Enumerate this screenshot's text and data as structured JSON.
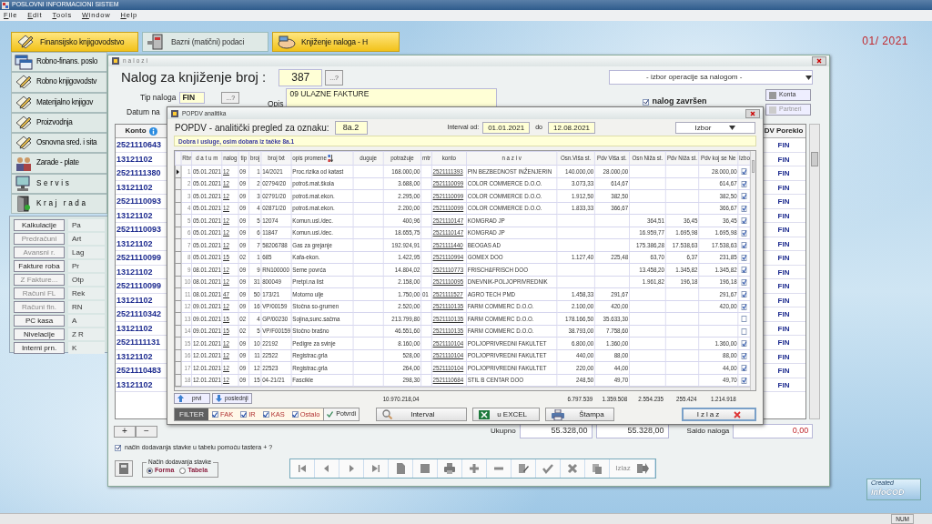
{
  "app": {
    "title": "POSLOVNI INFORMACIONI SISTEM",
    "period": "01/ 2021",
    "status": "NUM",
    "logo_lines": [
      "Created",
      "InfoCOD"
    ]
  },
  "menu": [
    "File",
    "Edit",
    "Tools",
    "Window",
    "Help"
  ],
  "modules_top": [
    {
      "label": "Finansijsko knjigovodstvo",
      "selected": true
    },
    {
      "label": "Bazni (matični) podaci",
      "selected": false
    },
    {
      "label": "Knjiženje naloga - H",
      "selected": true
    }
  ],
  "modules_side": [
    {
      "label": "Robno-finans. poslo",
      "kind": "plain"
    },
    {
      "label": "Robno knjigovodstv",
      "kind": "plain"
    },
    {
      "label": "Materijalno knjigov",
      "kind": "plain"
    },
    {
      "label": "Proizvodnja",
      "kind": "plain"
    },
    {
      "label": "Osnovna sred. i sita",
      "kind": "plain"
    },
    {
      "label": "Zarade - plate",
      "kind": "plain"
    },
    {
      "label": "Servis",
      "kind": "spaced"
    },
    {
      "label": "Kraj rada",
      "kind": "spaced"
    }
  ],
  "submenu": {
    "left": [
      {
        "label": "Kalkulacije",
        "disabled": false
      },
      {
        "label": "Predračuni",
        "disabled": true
      },
      {
        "label": "Avansni r.",
        "disabled": true
      },
      {
        "label": "Fakture roba",
        "disabled": false
      },
      {
        "label": "Z Fakture...",
        "disabled": true
      },
      {
        "label": "Računi FL",
        "disabled": true
      },
      {
        "label": "Računi fin.",
        "disabled": true
      },
      {
        "label": "PC kasa",
        "disabled": false
      },
      {
        "label": "Nivelacije",
        "disabled": false
      },
      {
        "label": "Interni prn.",
        "disabled": false
      }
    ],
    "right": [
      "Pa",
      "Art",
      "Lag",
      "Pr",
      "Otp",
      "Rek",
      "RN",
      "A",
      "Z R",
      "K"
    ]
  },
  "nalozi": {
    "title": "nalozi",
    "heading": "Nalog za knjiženje broj :",
    "number": "387",
    "lookup": "...?",
    "operation": "- izbor operacije sa nalogom -",
    "type_label": "Tip naloga",
    "type_value": "FIN",
    "type_lookup": "...?",
    "desc_label": "Opis",
    "desc_value": "09  ULAZNE FAKTURE",
    "date_label": "Datum na",
    "finished": {
      "label": "nalog završen",
      "checked": true
    },
    "buttons": [
      {
        "label": "Konta",
        "disabled": false
      },
      {
        "label": "Partneri",
        "disabled": true
      }
    ],
    "konto_header": "Konto",
    "konto": [
      "2521110643",
      "13121102",
      "2521111380",
      "13121102",
      "2521110093",
      "13121102",
      "2521110093",
      "13121102",
      "2521110099",
      "13121102",
      "2521110099",
      "13121102",
      "2521110342",
      "13121102",
      "2521111131",
      "13121102",
      "2521110483",
      "13121102"
    ],
    "origin_header": "DV Poreklo",
    "origin": [
      "FIN",
      "FIN",
      "FIN",
      "FIN",
      "FIN",
      "FIN",
      "FIN",
      "FIN",
      "FIN",
      "FIN",
      "FIN",
      "FIN",
      "FIN",
      "FIN",
      "FIN",
      "FIN",
      "FIN",
      "FIN"
    ],
    "row_buttons": [
      "+",
      "−"
    ],
    "total_label": "Ukupno",
    "totals": [
      "55.328,00",
      "55.328,00"
    ],
    "saldo_label": "Saldo naloga",
    "saldo": "0,00",
    "add_with_key": {
      "label": "način dodavanja stavke u tabelu pomoću tastera + ?",
      "checked": true
    },
    "add_mode": {
      "label": "Način dodavanja stavke",
      "options": [
        {
          "label": "Forma",
          "selected": true
        },
        {
          "label": "Tabela",
          "selected": false
        }
      ]
    },
    "exit_label": "Izlaz"
  },
  "popdv": {
    "title": "POPDV analitika",
    "heading": "POPDV - analitički pregled za oznaku:",
    "code": "8a.2",
    "from_label": "Interval od:",
    "from": "01.01.2021",
    "to_label": "do",
    "to": "12.08.2021",
    "choice": "Izbor",
    "subtitle": "Dobra i usluge, osim dobara iz tačke 8a.1",
    "columns": [
      "Rbr",
      "d a t u m",
      "nalog",
      "tip",
      "broj",
      "broj txt",
      "opis promene",
      "duguje",
      "potražuje",
      "mtr",
      "konto",
      "n a z i v",
      "Osn.Viša st.",
      "Pdv Viša st.",
      "Osn Niža st.",
      "Pdv Niža st.",
      "Pdv koj se Ne",
      "Izbo"
    ],
    "rows": [
      {
        "selected": true,
        "checked": true,
        "rbr": "1",
        "datum": "05.01.2021",
        "nalog": "12",
        "tip": "09",
        "broj": "1",
        "broj_txt": "14/2021",
        "opis": "Proc.rizika od katast",
        "potrazuje": "168.000,00",
        "konto": "2521111393",
        "naziv": "PIN BEZBEDNOST INŽENJERIN",
        "osn_visa": "140.000,00",
        "pdv_visa": "28.000,00",
        "pdv_koji": "28.000,00"
      },
      {
        "selected": false,
        "checked": true,
        "rbr": "2",
        "datum": "05.01.2021",
        "nalog": "12",
        "tip": "09",
        "broj": "2",
        "broj_txt": "02794/20",
        "opis": "potroš.mat.škola",
        "potrazuje": "3.688,00",
        "konto": "2521110099",
        "naziv": "COLOR COMMERCE D.O.O.",
        "osn_visa": "3.073,33",
        "pdv_visa": "614,67",
        "pdv_koji": "614,67"
      },
      {
        "selected": false,
        "checked": true,
        "rbr": "3",
        "datum": "05.01.2021",
        "nalog": "12",
        "tip": "09",
        "broj": "3",
        "broj_txt": "02791/20",
        "opis": "potroš.mat.ekon.",
        "potrazuje": "2.295,00",
        "konto": "2521110099",
        "naziv": "COLOR COMMERCE D.O.O.",
        "osn_visa": "1.912,50",
        "pdv_visa": "382,50",
        "pdv_koji": "382,50"
      },
      {
        "selected": false,
        "checked": true,
        "rbr": "4",
        "datum": "05.01.2021",
        "nalog": "12",
        "tip": "09",
        "broj": "4",
        "broj_txt": "02871/20",
        "opis": "potroš.mat.ekon.",
        "potrazuje": "2.200,00",
        "konto": "2521110099",
        "naziv": "COLOR COMMERCE D.O.O.",
        "osn_visa": "1.833,33",
        "pdv_visa": "366,67",
        "pdv_koji": "366,67"
      },
      {
        "selected": false,
        "checked": true,
        "rbr": "5",
        "datum": "05.01.2021",
        "nalog": "12",
        "tip": "09",
        "broj": "5",
        "broj_txt": "12074",
        "opis": "Komun.usl./dec.",
        "potrazuje": "400,96",
        "konto": "2521110147",
        "naziv": "KOMGRAD JP",
        "osn_niza": "364,51",
        "pdv_niza": "36,45",
        "pdv_koji": "36,45"
      },
      {
        "selected": false,
        "checked": true,
        "rbr": "6",
        "datum": "05.01.2021",
        "nalog": "12",
        "tip": "09",
        "broj": "6",
        "broj_txt": "11847",
        "opis": "Komun.usl./dec.",
        "potrazuje": "18.655,75",
        "konto": "2521110147",
        "naziv": "KOMGRAD JP",
        "osn_niza": "16.959,77",
        "pdv_niza": "1.695,98",
        "pdv_koji": "1.695,98"
      },
      {
        "selected": false,
        "checked": true,
        "rbr": "7",
        "datum": "05.01.2021",
        "nalog": "12",
        "tip": "09",
        "broj": "7",
        "broj_txt": "58206788",
        "opis": "Gas za grejanje",
        "potrazuje": "192.924,91",
        "konto": "2521111440",
        "naziv": "BEOGAS AD",
        "osn_niza": "175.386,28",
        "pdv_niza": "17.538,63",
        "pdv_koji": "17.538,63"
      },
      {
        "selected": false,
        "checked": true,
        "rbr": "8",
        "datum": "05.01.2021",
        "nalog": "15",
        "tip": "02",
        "broj": "1",
        "broj_txt": "685",
        "opis": "Kafa-ekon.",
        "potrazuje": "1.422,95",
        "konto": "2521110994",
        "naziv": "GOMEX DOO",
        "osn_visa": "1.127,40",
        "pdv_visa": "225,48",
        "osn_niza": "63,70",
        "pdv_niza": "6,37",
        "pdv_koji": "231,85"
      },
      {
        "selected": false,
        "checked": true,
        "rbr": "9",
        "datum": "08.01.2021",
        "nalog": "12",
        "tip": "09",
        "broj": "9",
        "broj_txt": "RN100000",
        "opis": "Seme povrća",
        "potrazuje": "14.804,02",
        "konto": "2521110773",
        "naziv": "FRISCH&FRISCH DOO",
        "osn_niza": "13.458,20",
        "pdv_niza": "1.345,82",
        "pdv_koji": "1.345,82"
      },
      {
        "selected": false,
        "checked": true,
        "rbr": "10",
        "datum": "08.01.2021",
        "nalog": "12",
        "tip": "09",
        "broj": "31",
        "broj_txt": "800049",
        "opis": "Pretpl.na list",
        "potrazuje": "2.158,00",
        "konto": "2521110095",
        "naziv": "DNEVNIK-POLJOPRIVREDNIK",
        "osn_niza": "1.961,82",
        "pdv_niza": "196,18",
        "pdv_koji": "196,18"
      },
      {
        "selected": false,
        "checked": true,
        "rbr": "11",
        "datum": "08.01.2021",
        "nalog": "47",
        "tip": "09",
        "broj": "50",
        "broj_txt": "173/21",
        "opis": "Motorno ulje",
        "potrazuje": "1.750,00",
        "mtr": "01",
        "konto": "2521111527",
        "naziv": "AGRO TECH PMD",
        "osn_visa": "1.458,33",
        "pdv_visa": "291,67",
        "pdv_koji": "291,67"
      },
      {
        "selected": false,
        "checked": true,
        "rbr": "12",
        "datum": "09.01.2021",
        "nalog": "12",
        "tip": "09",
        "broj": "16",
        "broj_txt": "VP/00159",
        "opis": "Stočna so-grumen",
        "potrazuje": "2.520,00",
        "konto": "2521110135",
        "naziv": "FARM COMMERC D.O.O.",
        "osn_visa": "2.100,00",
        "pdv_visa": "420,00",
        "pdv_koji": "420,00"
      },
      {
        "selected": false,
        "checked": false,
        "rbr": "13",
        "datum": "09.01.2021",
        "nalog": "15",
        "tip": "02",
        "broj": "4",
        "broj_txt": "GP/00230",
        "opis": "Sojina,sunc.sačma",
        "potrazuje": "213.799,80",
        "konto": "2521110135",
        "naziv": "FARM COMMERC D.O.O.",
        "osn_visa": "178.166,50",
        "pdv_visa": "35.633,30"
      },
      {
        "selected": false,
        "checked": false,
        "rbr": "14",
        "datum": "09.01.2021",
        "nalog": "15",
        "tip": "02",
        "broj": "5",
        "broj_txt": "VP/F00159",
        "opis": "Stočno brašno",
        "potrazuje": "46.551,60",
        "konto": "2521110135",
        "naziv": "FARM COMMERC D.O.O.",
        "osn_visa": "38.793,00",
        "pdv_visa": "7.758,60"
      },
      {
        "selected": false,
        "checked": true,
        "rbr": "15",
        "datum": "12.01.2021",
        "nalog": "12",
        "tip": "09",
        "broj": "10",
        "broj_txt": "22192",
        "opis": "Pedigre za svinje",
        "potrazuje": "8.160,00",
        "konto": "2521110104",
        "naziv": "POLJOPRIVREDNI FAKULTET",
        "osn_visa": "6.800,00",
        "pdv_visa": "1.360,00",
        "pdv_koji": "1.360,00"
      },
      {
        "selected": false,
        "checked": true,
        "rbr": "16",
        "datum": "12.01.2021",
        "nalog": "12",
        "tip": "09",
        "broj": "11",
        "broj_txt": "22522",
        "opis": "Registrac.grla",
        "potrazuje": "528,00",
        "konto": "2521110104",
        "naziv": "POLJOPRIVREDNI FAKULTET",
        "osn_visa": "440,00",
        "pdv_visa": "88,00",
        "pdv_koji": "88,00"
      },
      {
        "selected": false,
        "checked": true,
        "rbr": "17",
        "datum": "12.01.2021",
        "nalog": "12",
        "tip": "09",
        "broj": "12",
        "broj_txt": "22523",
        "opis": "Registrac.grla",
        "potrazuje": "264,00",
        "konto": "2521110104",
        "naziv": "POLJOPRIVREDNI FAKULTET",
        "osn_visa": "220,00",
        "pdv_visa": "44,00",
        "pdv_koji": "44,00"
      },
      {
        "selected": false,
        "checked": true,
        "rbr": "18",
        "datum": "12.01.2021",
        "nalog": "12",
        "tip": "09",
        "broj": "15",
        "broj_txt": "04-21/21",
        "opis": "Fascikle",
        "potrazuje": "298,30",
        "konto": "2521110684",
        "naziv": "STIL B CENTAR DOO",
        "osn_visa": "248,50",
        "pdv_visa": "49,70",
        "pdv_koji": "49,70"
      }
    ],
    "totals": {
      "potrazuje": "10.970.218,04",
      "osn_visa": "6.797.539",
      "pdv_visa": "1.359.508",
      "osn_niza": "2.554.235",
      "pdv_niza": "255.424",
      "pdv_koji": "1.214.918"
    },
    "first": "prvi",
    "last": "poslednji",
    "filter_label": "FILTER",
    "filters": [
      {
        "label": "FAK",
        "checked": true
      },
      {
        "label": "IR",
        "checked": true
      },
      {
        "label": "KAS",
        "checked": true
      },
      {
        "label": "Ostalo",
        "checked": true
      }
    ],
    "confirm": "Potvrdi",
    "interval": "Interval",
    "excel": "u EXCEL",
    "print": "Štampa",
    "exit": "Izlaz"
  }
}
